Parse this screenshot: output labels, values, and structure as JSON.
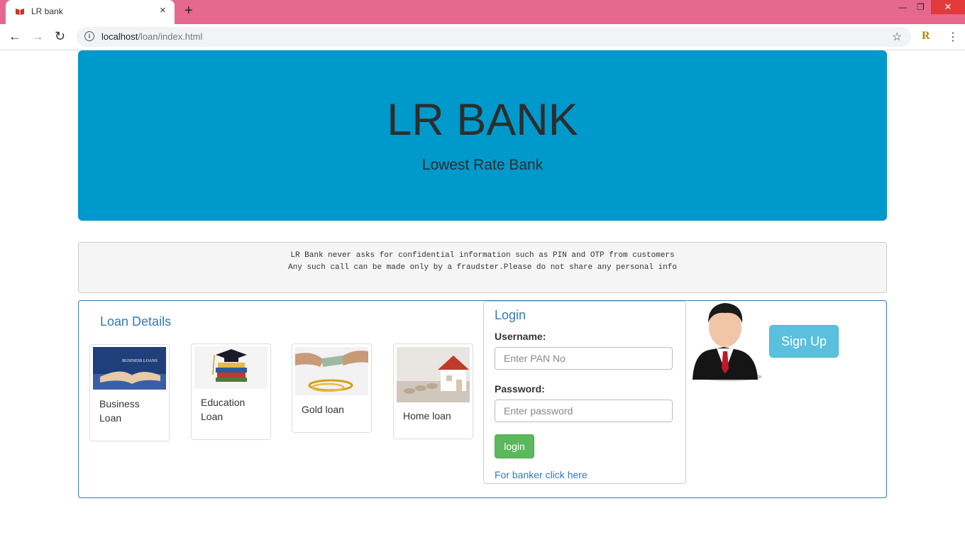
{
  "browser": {
    "tab_title": "LR bank",
    "new_tab": "+",
    "close_tab": "×",
    "url_host": "localhost",
    "url_path": "/loan/index.html"
  },
  "header": {
    "title": "LR BANK",
    "subtitle": "Lowest Rate Bank",
    "color": "#0099cc"
  },
  "notice": {
    "line1": "LR Bank never asks for confidential information such as PIN and OTP from customers",
    "line2": "Any such call can be made only by a fraudster.Please do not share any personal info"
  },
  "loans": {
    "title": "Loan Details",
    "items": [
      {
        "line1": "Business",
        "line2": "Loan",
        "image_text": "BUSINESS LOANS"
      },
      {
        "line1": "Education",
        "line2": "Loan"
      },
      {
        "line1": "Gold loan"
      },
      {
        "line1": "Home loan"
      }
    ]
  },
  "login": {
    "title": "Login",
    "username_label": "Username:",
    "username_placeholder": "Enter PAN No",
    "password_label": "Password:",
    "password_placeholder": "Enter password",
    "login_button": "login",
    "banker_link": "For banker click here"
  },
  "signup": {
    "label": "Sign Up"
  }
}
